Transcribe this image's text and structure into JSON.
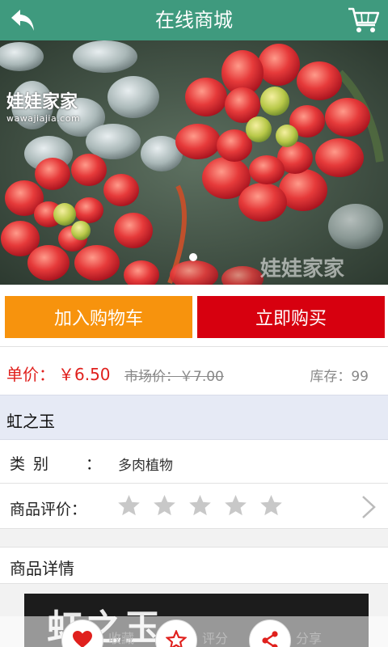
{
  "header": {
    "title": "在线商城",
    "back_icon": "back-arrow-icon",
    "cart_icon": "shopping-cart-icon",
    "bg_color": "#3f9a7e"
  },
  "banner": {
    "logo_text": "娃娃家家",
    "logo_url": "wawajiajia.com",
    "watermark": "娃娃家家",
    "slide_count": 1,
    "active_slide": 1
  },
  "actions": {
    "add_to_cart": "加入购物车",
    "buy_now": "立即购买",
    "add_to_cart_color": "#f7930d",
    "buy_now_color": "#d7000f"
  },
  "price": {
    "label": "单价：",
    "value": "￥6.50",
    "market": "市场价：￥7.00",
    "stock": "库存：99",
    "accent_color": "#e0201d"
  },
  "product": {
    "name": "虹之玉",
    "category_label": "类 别",
    "category_colon": "：",
    "category_value": "多肉植物",
    "rating_label": "商品评价：",
    "rating_stars_total": 5,
    "rating_stars_filled": 0
  },
  "detail": {
    "title": "商品详情",
    "image_text": "虹之玉"
  },
  "toolbar": {
    "items": [
      {
        "label": "收藏",
        "icon": "heart-icon"
      },
      {
        "label": "评分",
        "icon": "star-icon"
      },
      {
        "label": "分享",
        "icon": "share-icon"
      }
    ]
  }
}
